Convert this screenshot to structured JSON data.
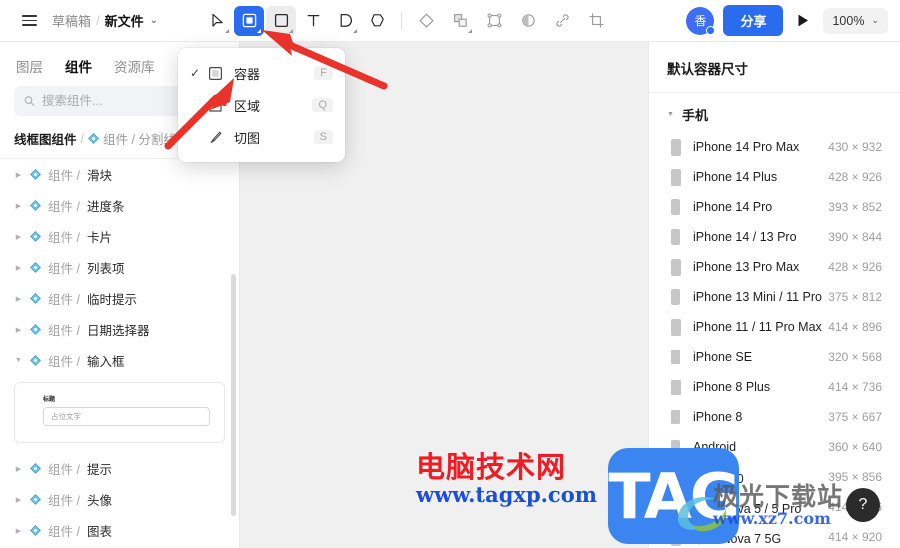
{
  "topbar": {
    "menu_icon": "hamburger-icon",
    "breadcrumb_root": "草稿箱",
    "breadcrumb_sep": "/",
    "breadcrumb_file": "新文件",
    "breadcrumb_caret": "⌄",
    "tools": [
      {
        "name": "cursor-tool",
        "icon": "cursor-icon",
        "state": "default"
      },
      {
        "name": "container-tool",
        "icon": "container-icon",
        "state": "active"
      },
      {
        "name": "frame-tool",
        "icon": "frame-icon",
        "state": "hover"
      },
      {
        "name": "text-tool",
        "icon": "text-icon",
        "state": "default"
      },
      {
        "name": "pen-tool",
        "icon": "pen-icon",
        "state": "default"
      },
      {
        "name": "shape-tool",
        "icon": "polygon-icon",
        "state": "default"
      }
    ],
    "tools2": [
      {
        "name": "diamond-tool",
        "icon": "diamond-icon"
      },
      {
        "name": "component-tool",
        "icon": "component-icon"
      },
      {
        "name": "group-tool",
        "icon": "selection-frame-icon"
      },
      {
        "name": "contrast-tool",
        "icon": "half-circle-icon"
      },
      {
        "name": "link-tool",
        "icon": "link-icon"
      },
      {
        "name": "crop-tool",
        "icon": "crop-icon"
      }
    ],
    "avatar_label": "香",
    "share_label": "分享",
    "play_icon": "play-icon",
    "zoom_level": "100%",
    "zoom_caret": "⌄"
  },
  "dropdown": {
    "items": [
      {
        "label": "容器",
        "shortcut": "F",
        "icon": "container-icon",
        "checked": true
      },
      {
        "label": "区域",
        "shortcut": "Q",
        "icon": "area-icon",
        "checked": false
      },
      {
        "label": "切图",
        "shortcut": "S",
        "icon": "slice-icon",
        "checked": false
      }
    ],
    "check_glyph": "✓"
  },
  "sidebar": {
    "tabs": [
      {
        "label": "图层",
        "active": false
      },
      {
        "label": "组件",
        "active": true
      },
      {
        "label": "资源库",
        "active": false
      }
    ],
    "search": {
      "icon": "search-icon",
      "placeholder": "搜索组件...",
      "value": ""
    },
    "library_crumb": {
      "root": "线框图组件",
      "sep": "/",
      "icon": "component-diamond-icon",
      "path": "组件 / 分割线"
    },
    "components": [
      {
        "prefix": "组件 / ",
        "name": "滑块",
        "expanded": false
      },
      {
        "prefix": "组件 / ",
        "name": "进度条",
        "expanded": false
      },
      {
        "prefix": "组件 / ",
        "name": "卡片",
        "expanded": false
      },
      {
        "prefix": "组件 / ",
        "name": "列表项",
        "expanded": false
      },
      {
        "prefix": "组件 / ",
        "name": "临时提示",
        "expanded": false
      },
      {
        "prefix": "组件 / ",
        "name": "日期选择器",
        "expanded": false
      },
      {
        "prefix": "组件 / ",
        "name": "输入框",
        "expanded": true
      }
    ],
    "preview": {
      "label": "标题",
      "placeholder": "占位文字"
    },
    "components_after": [
      {
        "prefix": "组件 / ",
        "name": "提示",
        "expanded": false
      },
      {
        "prefix": "组件 / ",
        "name": "头像",
        "expanded": false
      },
      {
        "prefix": "组件 / ",
        "name": "图表",
        "expanded": false
      }
    ],
    "collapse_glyph": "▼",
    "expand_glyph": "▶"
  },
  "rightpanel": {
    "title": "默认容器尺寸",
    "group_label": "手机",
    "group_glyph": "▼",
    "devices": [
      {
        "name": "iPhone 14 Pro Max",
        "size": "430 × 932",
        "w": 10,
        "h": 17,
        "r": 2
      },
      {
        "name": "iPhone 14 Plus",
        "size": "428 × 926",
        "w": 10,
        "h": 17,
        "r": 2
      },
      {
        "name": "iPhone 14 Pro",
        "size": "393 × 852",
        "w": 9,
        "h": 16,
        "r": 2
      },
      {
        "name": "iPhone 14 / 13 Pro",
        "size": "390 × 844",
        "w": 9,
        "h": 16,
        "r": 2
      },
      {
        "name": "iPhone 13 Pro Max",
        "size": "428 × 926",
        "w": 10,
        "h": 17,
        "r": 2
      },
      {
        "name": "iPhone 13 Mini / 11 Pro",
        "size": "375 × 812",
        "w": 9,
        "h": 16,
        "r": 2
      },
      {
        "name": "iPhone 11 / 11 Pro Max",
        "size": "414 × 896",
        "w": 10,
        "h": 17,
        "r": 2
      },
      {
        "name": "iPhone SE",
        "size": "320 × 568",
        "w": 9,
        "h": 14,
        "r": 1
      },
      {
        "name": "iPhone 8 Plus",
        "size": "414 × 736",
        "w": 10,
        "h": 15,
        "r": 1
      },
      {
        "name": "iPhone 8",
        "size": "375 × 667",
        "w": 9,
        "h": 14,
        "r": 1
      },
      {
        "name": "Android",
        "size": "360 × 640",
        "w": 9,
        "h": 15,
        "r": 2
      },
      {
        "name": "华为 P30",
        "size": "395 × 856",
        "w": 9,
        "h": 16,
        "r": 2
      },
      {
        "name": "华为 Nova 5 / 5 Pro",
        "size": "414 × 896",
        "w": 10,
        "h": 17,
        "r": 2
      },
      {
        "name": "华为 Nova 7 5G",
        "size": "414 × 920",
        "w": 10,
        "h": 17,
        "r": 2
      }
    ]
  },
  "watermarks": {
    "primary_cn": "电脑技术网",
    "primary_url": "www.tagxp.com",
    "logo_text": "TAG",
    "secondary_cn": "极光下载站",
    "secondary_url": "www.xz7.com",
    "help_glyph": "?"
  },
  "colors": {
    "accent": "#2a6cf0",
    "watermark_red": "#ee1c25",
    "watermark_blue": "#1a4fd6",
    "arrow_red": "#e8322a",
    "canvas_bg": "#f0f0f0"
  }
}
